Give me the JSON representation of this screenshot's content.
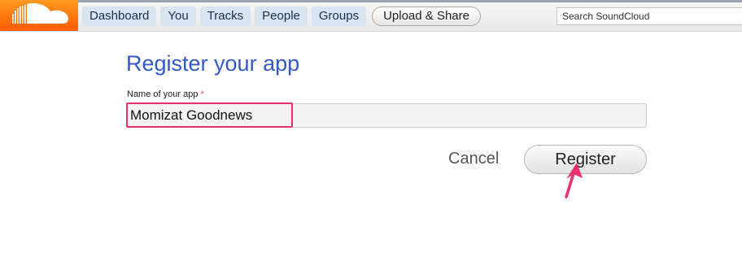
{
  "header": {
    "nav": [
      {
        "label": "Dashboard"
      },
      {
        "label": "You"
      },
      {
        "label": "Tracks"
      },
      {
        "label": "People"
      },
      {
        "label": "Groups"
      }
    ],
    "upload_label": "Upload & Share",
    "search_placeholder": "Search SoundCloud"
  },
  "form": {
    "title": "Register your app",
    "name_label": "Name of your app",
    "required_mark": "*",
    "name_value": "Momizat Goodnews",
    "cancel_label": "Cancel",
    "register_label": "Register"
  },
  "colors": {
    "title": "#3558c7",
    "annotation": "#e9326c",
    "logo": "#ff6a00"
  },
  "icons": {
    "logo": "soundcloud-cloud-logo",
    "annotation_arrow": "pointer-arrow"
  }
}
